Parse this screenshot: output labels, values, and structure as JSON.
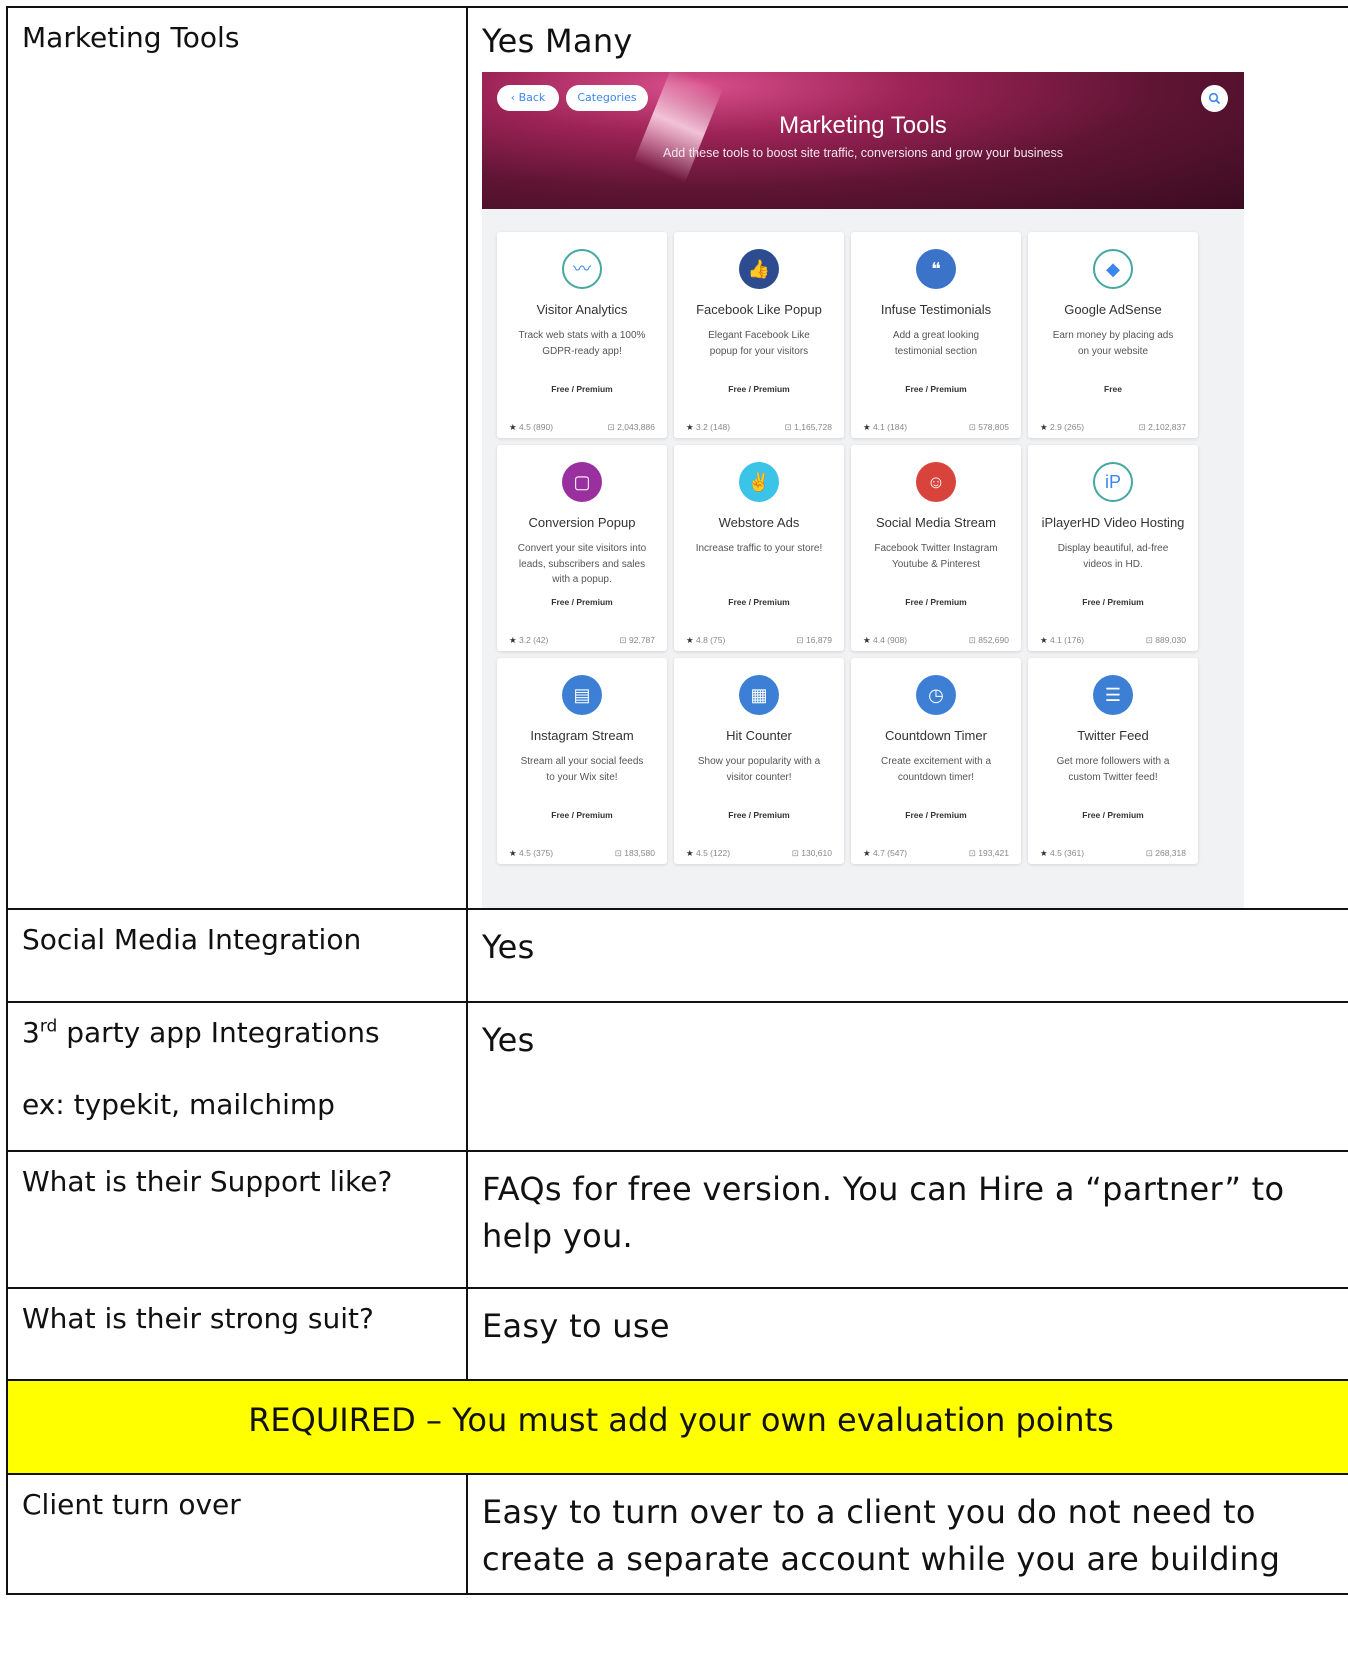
{
  "rows": [
    {
      "label": "Marketing Tools",
      "value": "Yes Many"
    },
    {
      "label": "Social Media Integration",
      "value": "Yes"
    },
    {
      "label_pre": "3",
      "label_sup": "rd",
      "label_post": " party app Integrations",
      "label_sub": "ex: typekit, mailchimp",
      "value": "Yes"
    },
    {
      "label": "What is their Support like?",
      "value": "FAQs for free version. You can Hire a “partner” to help you."
    },
    {
      "label": "What is their strong suit?",
      "value": "Easy to use"
    },
    {
      "label": "Client turn over",
      "value": "Easy to turn over to a client you do not need to create a separate account  while you are building"
    }
  ],
  "required_banner": "REQUIRED – You must add  your own evaluation points",
  "screenshot": {
    "back_label": "‹ Back",
    "categories_label": "Categories",
    "title": "Marketing Tools",
    "subtitle": "Add these tools to boost site traffic, conversions and grow your business",
    "cards": [
      {
        "name": "Visitor Analytics",
        "desc": "Track web stats with a 100% GDPR-ready app!",
        "price": "Free / Premium",
        "rating": "4.5 (890)",
        "installs": "2,043,886",
        "icon": "analytics-icon",
        "color": "#ffffff"
      },
      {
        "name": "Facebook Like Popup",
        "desc": "Elegant Facebook Like popup for your visitors",
        "price": "Free / Premium",
        "rating": "3.2 (148)",
        "installs": "1,165,728",
        "icon": "thumbs-up-icon",
        "color": "#2d4b8f"
      },
      {
        "name": "Infuse Testimonials",
        "desc": "Add a great looking testimonial section",
        "price": "Free / Premium",
        "rating": "4.1 (184)",
        "installs": "578,805",
        "icon": "quote-icon",
        "color": "#3a73c8"
      },
      {
        "name": "Google AdSense",
        "desc": "Earn money by placing ads on your website",
        "price": "Free",
        "rating": "2.9 (265)",
        "installs": "2,102,837",
        "icon": "adsense-icon",
        "color": "#ffffff"
      },
      {
        "name": "Conversion Popup",
        "desc": "Convert your site visitors into leads, subscribers and sales with a popup.",
        "price": "Free / Premium",
        "rating": "3.2 (42)",
        "installs": "92,787",
        "icon": "popup-window-icon",
        "color": "#9a2fa0"
      },
      {
        "name": "Webstore Ads",
        "desc": "Increase traffic to your store!",
        "price": "Free / Premium",
        "rating": "4.8 (75)",
        "installs": "16,879",
        "icon": "webstore-ads-icon",
        "color": "#3cc4e8"
      },
      {
        "name": "Social Media Stream",
        "desc": "Facebook Twitter Instagram Youtube & Pinterest",
        "price": "Free / Premium",
        "rating": "4.4 (908)",
        "installs": "852,690",
        "icon": "social-stream-icon",
        "color": "#d8443b"
      },
      {
        "name": "iPlayerHD Video Hosting",
        "desc": "Display beautiful, ad-free videos in HD.",
        "price": "Free / Premium",
        "rating": "4.1 (176)",
        "installs": "889,030",
        "icon": "iplayerhd-icon",
        "color": "#ffffff"
      },
      {
        "name": "Instagram Stream",
        "desc": "Stream all your social feeds to your Wix site!",
        "price": "Free / Premium",
        "rating": "4.5 (375)",
        "installs": "183,580",
        "icon": "instagram-stream-icon",
        "color": "#3e7fd6"
      },
      {
        "name": "Hit Counter",
        "desc": "Show your popularity with a visitor counter!",
        "price": "Free / Premium",
        "rating": "4.5 (122)",
        "installs": "130,610",
        "icon": "hit-counter-icon",
        "color": "#3e7fd6"
      },
      {
        "name": "Countdown Timer",
        "desc": "Create excitement with a countdown timer!",
        "price": "Free / Premium",
        "rating": "4.7 (547)",
        "installs": "193,421",
        "icon": "clock-icon",
        "color": "#3e7fd6"
      },
      {
        "name": "Twitter Feed",
        "desc": "Get more followers with a custom Twitter feed!",
        "price": "Free / Premium",
        "rating": "4.5 (361)",
        "installs": "268,318",
        "icon": "twitter-feed-icon",
        "color": "#3e7fd6"
      }
    ]
  }
}
